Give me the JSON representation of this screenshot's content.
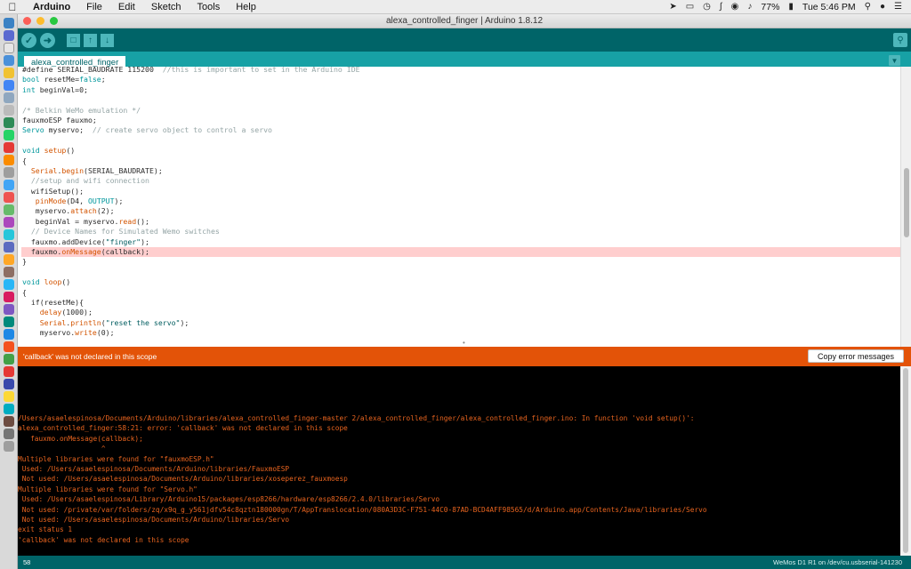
{
  "menubar": {
    "app": "Arduino",
    "items": [
      "File",
      "Edit",
      "Sketch",
      "Tools",
      "Help"
    ],
    "battery": "77%",
    "clock": "Tue 5:46 PM"
  },
  "window": {
    "title": "alexa_controlled_finger | Arduino 1.8.12"
  },
  "tabs": [
    {
      "label": "alexa_controlled_finger"
    }
  ],
  "code_lines": [
    "#define SERIAL_BAUDRATE 115200  //this is important to set in the Arduino IDE",
    "bool resetMe=false;",
    "int beginVal=0;",
    "",
    "/* Belkin WeMo emulation */",
    "fauxmoESP fauxmo;",
    "Servo myservo;  // create servo object to control a servo",
    "",
    "void setup()",
    "{",
    "  Serial.begin(SERIAL_BAUDRATE);",
    "  //setup and wifi connection",
    "  wifiSetup();",
    "   pinMode(D4, OUTPUT);",
    "   myservo.attach(2);",
    "   beginVal = myservo.read();",
    "  // Device Names for Simulated Wemo switches",
    "  fauxmo.addDevice(\"finger\");",
    "  fauxmo.onMessage(callback);",
    "}",
    "",
    "void loop()",
    "{",
    "  if(resetMe){",
    "    delay(1000);",
    "    Serial.println(\"reset the servo\");",
    "    myservo.write(0);"
  ],
  "error_line_index": 18,
  "error_bar": {
    "message": "'callback' was not declared in this scope",
    "copy_button": "Copy error messages"
  },
  "console_lines": [
    "/Users/asaelespinosa/Documents/Arduino/libraries/alexa_controlled_finger-master 2/alexa_controlled_finger/alexa_controlled_finger.ino: In function 'void setup()':",
    "alexa_controlled_finger:58:21: error: 'callback' was not declared in this scope",
    "   fauxmo.onMessage(callback);",
    "                    ^",
    "Multiple libraries were found for \"fauxmoESP.h\"",
    " Used: /Users/asaelespinosa/Documents/Arduino/libraries/FauxmoESP",
    " Not used: /Users/asaelespinosa/Documents/Arduino/libraries/xoseperez_fauxmoesp",
    "Multiple libraries were found for \"Servo.h\"",
    " Used: /Users/asaelespinosa/Library/Arduino15/packages/esp8266/hardware/esp8266/2.4.0/libraries/Servo",
    " Not used: /private/var/folders/zq/x9q_g_y561jdfv54c8qztn180000gn/T/AppTranslocation/080A3D3C-F751-44C0-87AD-BCD4AFF98565/d/Arduino.app/Contents/Java/libraries/Servo",
    " Not used: /Users/asaelespinosa/Documents/Arduino/libraries/Servo",
    "exit status 1",
    "'callback' was not declared in this scope"
  ],
  "status": {
    "line_number": "58",
    "board": "WeMos D1 R1 on /dev/cu.usbserial-141230"
  },
  "colors": {
    "toolbar": "#006468",
    "tabbar": "#17a1a5",
    "error": "#e35308",
    "console_text": "#e8641f"
  }
}
